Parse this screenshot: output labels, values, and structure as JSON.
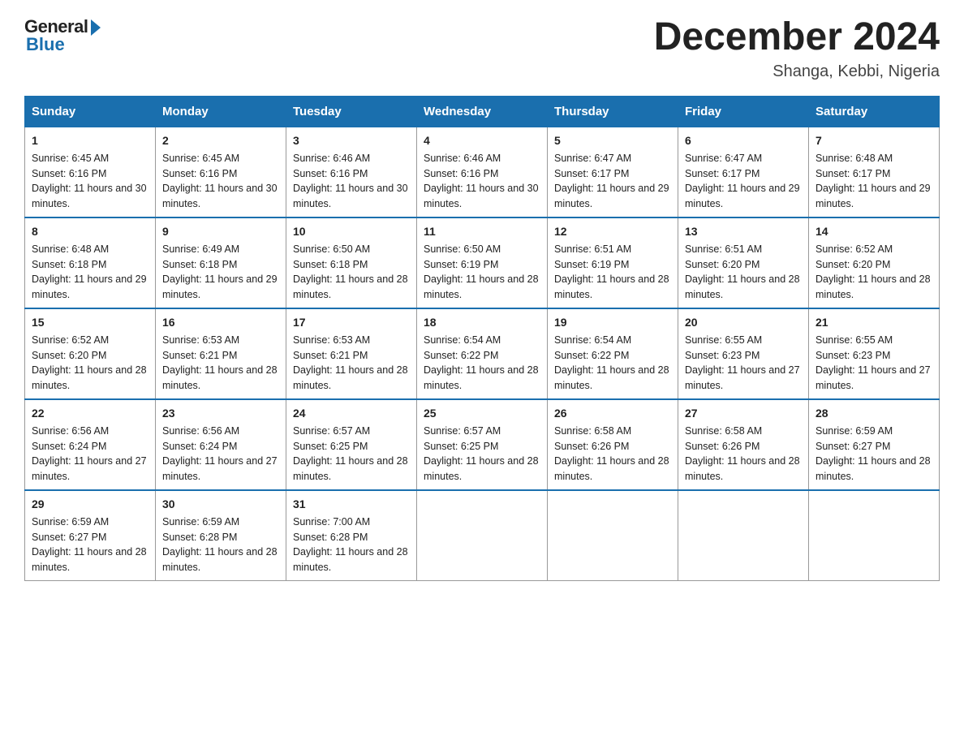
{
  "logo": {
    "general": "General",
    "blue": "Blue"
  },
  "header": {
    "month": "December 2024",
    "location": "Shanga, Kebbi, Nigeria"
  },
  "weekdays": [
    "Sunday",
    "Monday",
    "Tuesday",
    "Wednesday",
    "Thursday",
    "Friday",
    "Saturday"
  ],
  "weeks": [
    [
      {
        "day": "1",
        "sunrise": "6:45 AM",
        "sunset": "6:16 PM",
        "daylight": "11 hours and 30 minutes."
      },
      {
        "day": "2",
        "sunrise": "6:45 AM",
        "sunset": "6:16 PM",
        "daylight": "11 hours and 30 minutes."
      },
      {
        "day": "3",
        "sunrise": "6:46 AM",
        "sunset": "6:16 PM",
        "daylight": "11 hours and 30 minutes."
      },
      {
        "day": "4",
        "sunrise": "6:46 AM",
        "sunset": "6:16 PM",
        "daylight": "11 hours and 30 minutes."
      },
      {
        "day": "5",
        "sunrise": "6:47 AM",
        "sunset": "6:17 PM",
        "daylight": "11 hours and 29 minutes."
      },
      {
        "day": "6",
        "sunrise": "6:47 AM",
        "sunset": "6:17 PM",
        "daylight": "11 hours and 29 minutes."
      },
      {
        "day": "7",
        "sunrise": "6:48 AM",
        "sunset": "6:17 PM",
        "daylight": "11 hours and 29 minutes."
      }
    ],
    [
      {
        "day": "8",
        "sunrise": "6:48 AM",
        "sunset": "6:18 PM",
        "daylight": "11 hours and 29 minutes."
      },
      {
        "day": "9",
        "sunrise": "6:49 AM",
        "sunset": "6:18 PM",
        "daylight": "11 hours and 29 minutes."
      },
      {
        "day": "10",
        "sunrise": "6:50 AM",
        "sunset": "6:18 PM",
        "daylight": "11 hours and 28 minutes."
      },
      {
        "day": "11",
        "sunrise": "6:50 AM",
        "sunset": "6:19 PM",
        "daylight": "11 hours and 28 minutes."
      },
      {
        "day": "12",
        "sunrise": "6:51 AM",
        "sunset": "6:19 PM",
        "daylight": "11 hours and 28 minutes."
      },
      {
        "day": "13",
        "sunrise": "6:51 AM",
        "sunset": "6:20 PM",
        "daylight": "11 hours and 28 minutes."
      },
      {
        "day": "14",
        "sunrise": "6:52 AM",
        "sunset": "6:20 PM",
        "daylight": "11 hours and 28 minutes."
      }
    ],
    [
      {
        "day": "15",
        "sunrise": "6:52 AM",
        "sunset": "6:20 PM",
        "daylight": "11 hours and 28 minutes."
      },
      {
        "day": "16",
        "sunrise": "6:53 AM",
        "sunset": "6:21 PM",
        "daylight": "11 hours and 28 minutes."
      },
      {
        "day": "17",
        "sunrise": "6:53 AM",
        "sunset": "6:21 PM",
        "daylight": "11 hours and 28 minutes."
      },
      {
        "day": "18",
        "sunrise": "6:54 AM",
        "sunset": "6:22 PM",
        "daylight": "11 hours and 28 minutes."
      },
      {
        "day": "19",
        "sunrise": "6:54 AM",
        "sunset": "6:22 PM",
        "daylight": "11 hours and 28 minutes."
      },
      {
        "day": "20",
        "sunrise": "6:55 AM",
        "sunset": "6:23 PM",
        "daylight": "11 hours and 27 minutes."
      },
      {
        "day": "21",
        "sunrise": "6:55 AM",
        "sunset": "6:23 PM",
        "daylight": "11 hours and 27 minutes."
      }
    ],
    [
      {
        "day": "22",
        "sunrise": "6:56 AM",
        "sunset": "6:24 PM",
        "daylight": "11 hours and 27 minutes."
      },
      {
        "day": "23",
        "sunrise": "6:56 AM",
        "sunset": "6:24 PM",
        "daylight": "11 hours and 27 minutes."
      },
      {
        "day": "24",
        "sunrise": "6:57 AM",
        "sunset": "6:25 PM",
        "daylight": "11 hours and 28 minutes."
      },
      {
        "day": "25",
        "sunrise": "6:57 AM",
        "sunset": "6:25 PM",
        "daylight": "11 hours and 28 minutes."
      },
      {
        "day": "26",
        "sunrise": "6:58 AM",
        "sunset": "6:26 PM",
        "daylight": "11 hours and 28 minutes."
      },
      {
        "day": "27",
        "sunrise": "6:58 AM",
        "sunset": "6:26 PM",
        "daylight": "11 hours and 28 minutes."
      },
      {
        "day": "28",
        "sunrise": "6:59 AM",
        "sunset": "6:27 PM",
        "daylight": "11 hours and 28 minutes."
      }
    ],
    [
      {
        "day": "29",
        "sunrise": "6:59 AM",
        "sunset": "6:27 PM",
        "daylight": "11 hours and 28 minutes."
      },
      {
        "day": "30",
        "sunrise": "6:59 AM",
        "sunset": "6:28 PM",
        "daylight": "11 hours and 28 minutes."
      },
      {
        "day": "31",
        "sunrise": "7:00 AM",
        "sunset": "6:28 PM",
        "daylight": "11 hours and 28 minutes."
      },
      null,
      null,
      null,
      null
    ]
  ]
}
